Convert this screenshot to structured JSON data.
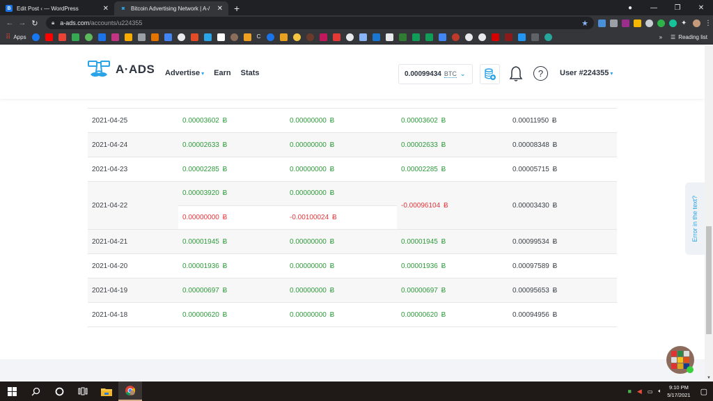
{
  "browser": {
    "tabs": [
      {
        "title": "Edit Post ‹ — WordPress",
        "favicon": "B",
        "favicon_color": "#1a73e8",
        "active": false
      },
      {
        "title": "Bitcoin Advertising Network | A-/",
        "favicon": "a-ads",
        "favicon_color": "#2aa4e6",
        "active": true
      }
    ],
    "new_tab": "+",
    "url_host": "a-ads.com",
    "url_path": "/accounts/u224355",
    "bookmarks_apps": "Apps",
    "reading_list": "Reading list",
    "more_bookmarks": "»"
  },
  "site": {
    "logo_text": "A·ADS",
    "nav": [
      {
        "label": "Advertise",
        "has_dropdown": true
      },
      {
        "label": "Earn",
        "has_dropdown": false
      },
      {
        "label": "Stats",
        "has_dropdown": false
      }
    ],
    "balance": "0.00099434",
    "currency": "BTC",
    "user": "User #224355",
    "accent": "#2aa4e6"
  },
  "table": {
    "currency_symbol": "Ƀ",
    "rows": [
      {
        "date": "2021-04-25",
        "col2": "0.00003602",
        "col3": "0.00000000",
        "col4": "0.00003602",
        "col5": "0.00011950"
      },
      {
        "date": "2021-04-24",
        "col2": "0.00002633",
        "col3": "0.00000000",
        "col4": "0.00002633",
        "col5": "0.00008348"
      },
      {
        "date": "2021-04-23",
        "col2": "0.00002285",
        "col3": "0.00000000",
        "col4": "0.00002285",
        "col5": "0.00005715"
      },
      {
        "date": "2021-04-22",
        "col2": "0.00003920",
        "col3": "0.00000000",
        "col2b": "0.00000000",
        "col3b": "-0.00100024",
        "col4": "-0.00096104",
        "col5": "0.00003430"
      },
      {
        "date": "2021-04-21",
        "col2": "0.00001945",
        "col3": "0.00000000",
        "col4": "0.00001945",
        "col5": "0.00099534"
      },
      {
        "date": "2021-04-20",
        "col2": "0.00001936",
        "col3": "0.00000000",
        "col4": "0.00001936",
        "col5": "0.00097589"
      },
      {
        "date": "2021-04-19",
        "col2": "0.00000697",
        "col3": "0.00000000",
        "col4": "0.00000697",
        "col5": "0.00095653"
      },
      {
        "date": "2021-04-18",
        "col2": "0.00000620",
        "col3": "0.00000000",
        "col4": "0.00000620",
        "col5": "0.00094956"
      }
    ],
    "colors": {
      "positive": "#2e9a3b",
      "negative": "#e8343a",
      "neutral": "#3a3f45"
    }
  },
  "feedback_tab": "Error in the text?",
  "taskbar": {
    "time": "9:10 PM",
    "date": "5/17/2021"
  }
}
